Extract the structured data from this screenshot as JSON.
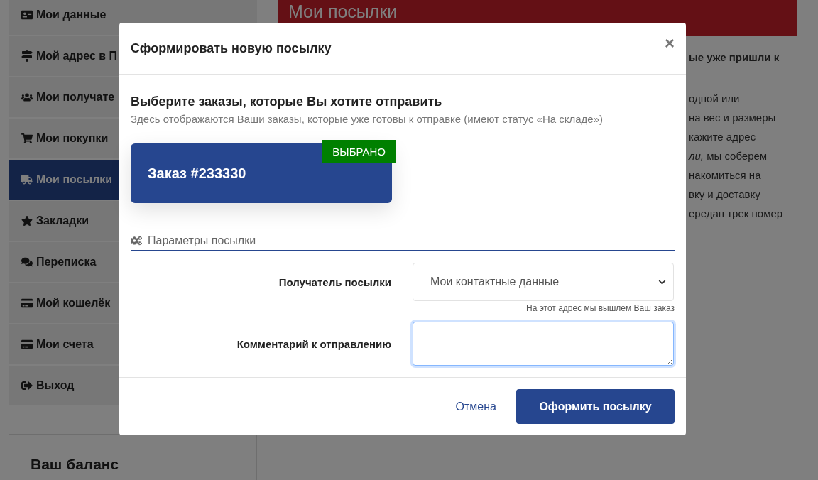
{
  "sidebar": {
    "items": [
      {
        "label": "Мои данные",
        "selected": false
      },
      {
        "label": "Мой адрес в П",
        "selected": false
      },
      {
        "label": "Мои получате",
        "selected": false
      },
      {
        "label": "Мои покупки",
        "selected": false
      },
      {
        "label": "Мои посылки",
        "selected": true
      },
      {
        "label": "Закладки",
        "selected": false
      },
      {
        "label": "Переписка",
        "selected": false
      },
      {
        "label": "Мой кошелёк",
        "selected": false
      },
      {
        "label": "Мои счета",
        "selected": false
      },
      {
        "label": "Выход",
        "selected": false
      }
    ]
  },
  "balance": {
    "title": "Ваш баланс"
  },
  "page": {
    "title": "Мои посылки",
    "intro": "ые уже пришли к",
    "lines": [
      "одной или",
      "на вес и размеры",
      "кажите адрес",
      "*ли,* мы соберем",
      "накомиться на",
      "вку и доставку",
      "ередан трек номер"
    ]
  },
  "modal": {
    "title": "Сформировать новую посылку",
    "close": "×",
    "heading": "Выберите заказы, которые Вы хотите отправить",
    "subtitle": "Здесь отображаются Ваши заказы, которые уже готовы к отправке (имеют статус «На складе»)",
    "orders": [
      {
        "label": "Заказ #233330",
        "selected": true,
        "badge": "ВЫБРАНО"
      }
    ],
    "section": "Параметры посылки",
    "recipient": {
      "label": "Получатель посылки",
      "value": "Мои контактные данные",
      "hint": "На этот адрес мы вышлем Ваш заказ"
    },
    "comment": {
      "label": "Комментарий к отправлению",
      "focused": true
    },
    "cancel": "Отмена",
    "submit": "Оформить посылку"
  }
}
